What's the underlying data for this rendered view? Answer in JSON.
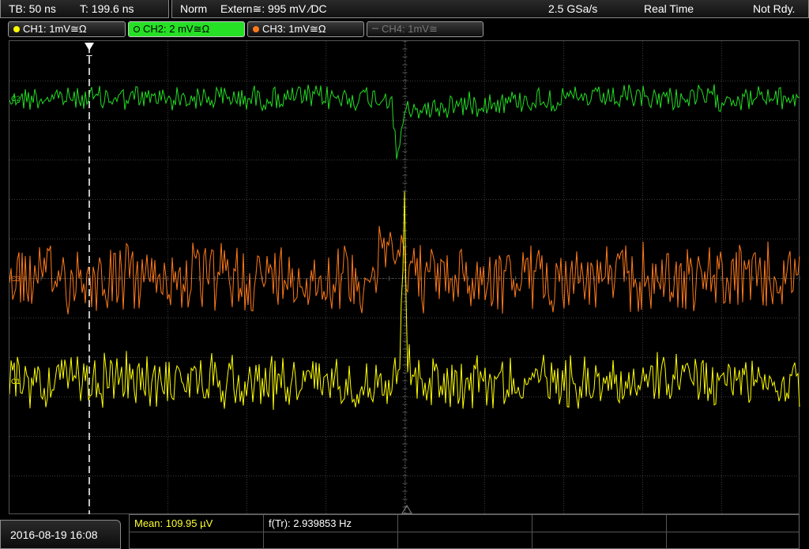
{
  "topbar": {
    "timebase": "TB: 50 ns",
    "trigger_time": "T: 199.6 ns",
    "mode": "Norm",
    "trigger_source": "Extern≅: 995 mV ⁄DC",
    "sample_rate": "2.5 GSa/s",
    "acq_mode": "Real Time",
    "status": "Not Rdy."
  },
  "channels": {
    "ch1": {
      "label": "CH1: 1mV≅Ω",
      "color": "#ffff00"
    },
    "ch2": {
      "label": "CH2: 2 mV≅Ω",
      "color": "#22dd22"
    },
    "ch3": {
      "label": "CH3: 1mV≅Ω",
      "color": "#ff7a1a"
    },
    "ch4": {
      "label": "CH4: 1mV≅",
      "color": "#777777"
    }
  },
  "bottombar": {
    "datetime": "2016-08-19 16:08",
    "mean": "Mean: 109.95 µV",
    "freq": "f(Tr): 2.939853 Hz"
  },
  "colors": {
    "grid": "#3c3c3c",
    "trigger_marker": "#ffffff",
    "mean_text": "#ffff33"
  },
  "trace_markers": {
    "ch1": "C1",
    "ch2": "C2",
    "ch3": "C3"
  }
}
